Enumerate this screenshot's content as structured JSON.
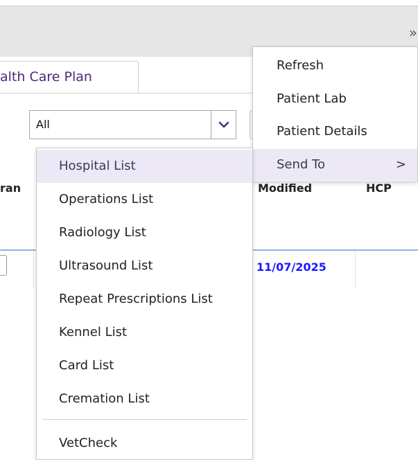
{
  "header": {
    "expand_glyph": "»"
  },
  "tab": {
    "label": "alth Care Plan"
  },
  "filter": {
    "selected": "All"
  },
  "table": {
    "headers": [
      "ran",
      "Modified",
      "HCP"
    ],
    "rows": [
      {
        "modified": "11/07/2025"
      }
    ]
  },
  "context_menu": {
    "items": [
      {
        "label": "Refresh"
      },
      {
        "label": "Patient Lab"
      },
      {
        "label": "Patient Details"
      },
      {
        "label": "Send To",
        "arrow": ">"
      }
    ]
  },
  "send_to_submenu": {
    "items": [
      {
        "label": "Hospital List"
      },
      {
        "label": "Operations List"
      },
      {
        "label": "Radiology List"
      },
      {
        "label": "Ultrasound List"
      },
      {
        "label": "Repeat Prescriptions List"
      },
      {
        "label": "Kennel List"
      },
      {
        "label": "Card List"
      },
      {
        "label": "Cremation List"
      }
    ],
    "extra_item": {
      "label": "VetCheck"
    }
  },
  "colors": {
    "tab_text": "#4a2a7a",
    "highlight": "#ece8f6",
    "date_link": "#1a1aff",
    "row_border": "#8fb4e0"
  }
}
